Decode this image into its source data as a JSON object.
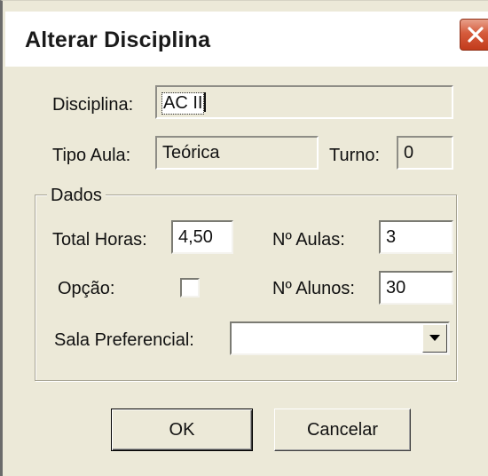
{
  "window": {
    "title": "Alterar Disciplina"
  },
  "disciplina": {
    "label": "Disciplina:",
    "value": "AC II"
  },
  "tipo_aula": {
    "label": "Tipo Aula:",
    "value": "Teórica"
  },
  "turno": {
    "label": "Turno:",
    "value": "0"
  },
  "dados": {
    "legend": "Dados",
    "total_horas": {
      "label": "Total Horas:",
      "value": "4,50"
    },
    "num_aulas": {
      "label": "Nº Aulas:",
      "value": "3"
    },
    "opcao": {
      "label": "Opção:",
      "checked": false
    },
    "num_alunos": {
      "label": "Nº Alunos:",
      "value": "30"
    },
    "sala_preferencial": {
      "label": "Sala Preferencial:",
      "value": ""
    }
  },
  "buttons": {
    "ok": "OK",
    "cancel": "Cancelar"
  },
  "icons": {
    "close": "close-icon",
    "dropdown": "chevron-down-icon"
  }
}
